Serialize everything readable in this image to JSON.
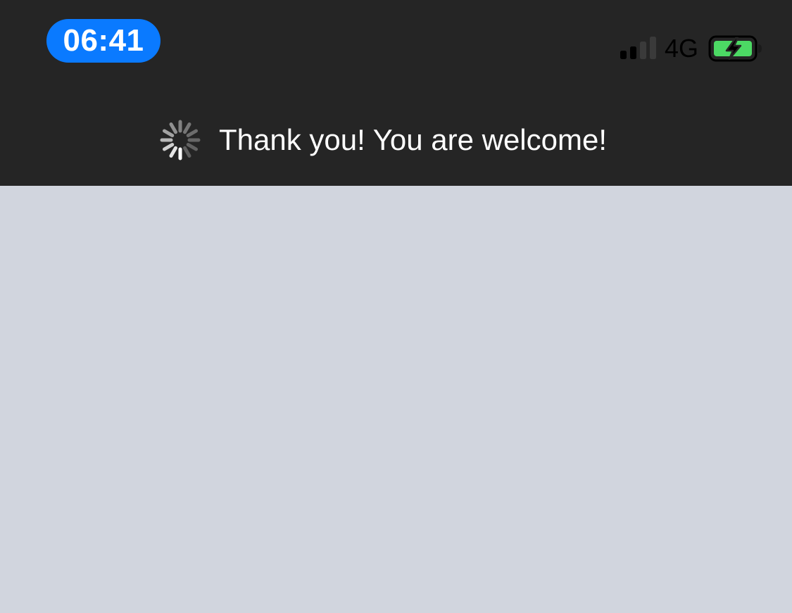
{
  "status_bar": {
    "time": "06:41",
    "network": "4G",
    "signal_bars_active": 2,
    "signal_bars_total": 4,
    "battery_charging": true,
    "time_pill_color": "#0a7aff",
    "battery_color": "#4cd964"
  },
  "banner": {
    "message": "Thank you! You are welcome!",
    "icon": "loading-spinner-icon"
  },
  "colors": {
    "header_bg": "#252525",
    "content_bg": "#d1d5de"
  }
}
